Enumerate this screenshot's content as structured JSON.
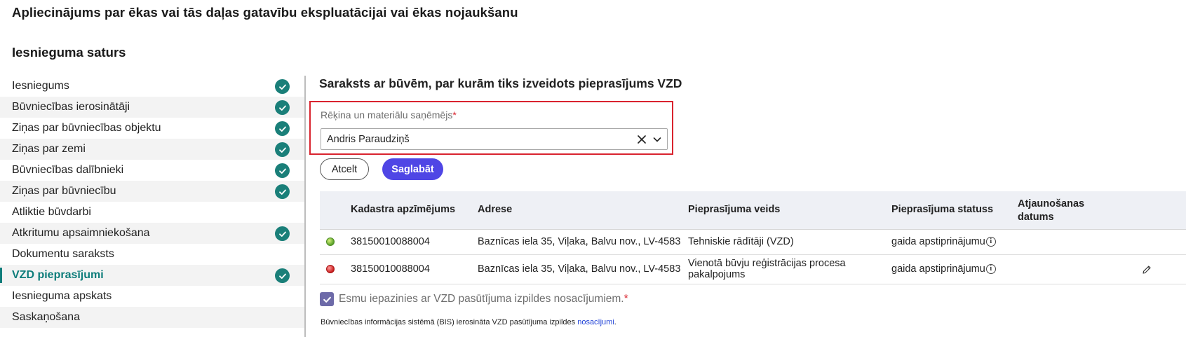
{
  "page": {
    "title": "Apliecinājums par ēkas vai tās daļas gatavību ekspluatācijai vai ēkas nojaukšanu",
    "section_title": "Iesnieguma saturs"
  },
  "sidebar": {
    "items": [
      {
        "label": "Iesniegums",
        "done": true
      },
      {
        "label": "Būvniecības ierosinātāji",
        "done": true
      },
      {
        "label": "Ziņas par būvniecības objektu",
        "done": true
      },
      {
        "label": "Ziņas par zemi",
        "done": true
      },
      {
        "label": "Būvniecības dalībnieki",
        "done": true
      },
      {
        "label": "Ziņas par būvniecību",
        "done": true
      },
      {
        "label": "Atliktie būvdarbi",
        "done": false
      },
      {
        "label": "Atkritumu apsaimniekošana",
        "done": true
      },
      {
        "label": "Dokumentu saraksts",
        "done": false
      },
      {
        "label": "VZD pieprasījumi",
        "done": true,
        "active": true
      },
      {
        "label": "Iesnieguma apskats",
        "done": false
      },
      {
        "label": "Saskaņošana",
        "done": false
      }
    ]
  },
  "main": {
    "title": "Saraksts ar būvēm, par kurām tiks izveidots pieprasījums VZD",
    "recipient_field": {
      "label": "Rēķina un materiālu saņēmējs",
      "required_mark": "*",
      "value": "Andris Paraudziņš"
    },
    "buttons": {
      "cancel": "Atcelt",
      "save": "Saglabāt"
    },
    "table": {
      "headers": {
        "cadastre": "Kadastra apzīmējums",
        "address": "Adrese",
        "request_type": "Pieprasījuma veids",
        "request_status": "Pieprasījuma statuss",
        "updated_line1": "Atjaunošanas",
        "updated_line2": "datums"
      },
      "rows": [
        {
          "status_color": "green",
          "cadastre": "38150010088004",
          "address": "Baznīcas iela 35, Viļaka, Balvu nov., LV-4583",
          "type_line1": "Tehniskie rādītāji (VZD)",
          "type_line2": "",
          "status": "gaida apstiprinājumu",
          "info_glyph": "i"
        },
        {
          "status_color": "red",
          "cadastre": "38150010088004",
          "address": "Baznīcas iela 35, Viļaka, Balvu nov., LV-4583",
          "type_line1": "Vienotā būvju reģistrācijas procesa",
          "type_line2": "pakalpojums",
          "status": "gaida apstiprinājumu",
          "info_glyph": "i"
        }
      ]
    },
    "agreement": {
      "label": "Esmu iepazinies ar VZD pasūtījuma izpildes nosacījumiem.",
      "required_mark": "*",
      "checked": true
    },
    "footnote": {
      "text": "Būvniecības informācijas sistēmā (BIS) ierosināta VZD pasūtījuma izpildes ",
      "link": "nosacījumi",
      "end": "."
    }
  },
  "colors": {
    "accent_teal": "#1a7f79",
    "primary_button": "#4f46e5",
    "error_border": "#d9232e",
    "link": "#1d3fd6"
  },
  "icons": {
    "done": "check-circle-icon",
    "clear": "close-icon",
    "dropdown": "chevron-down-icon",
    "info": "info-icon",
    "edit": "pencil-icon",
    "checkbox": "checkmark-icon"
  }
}
